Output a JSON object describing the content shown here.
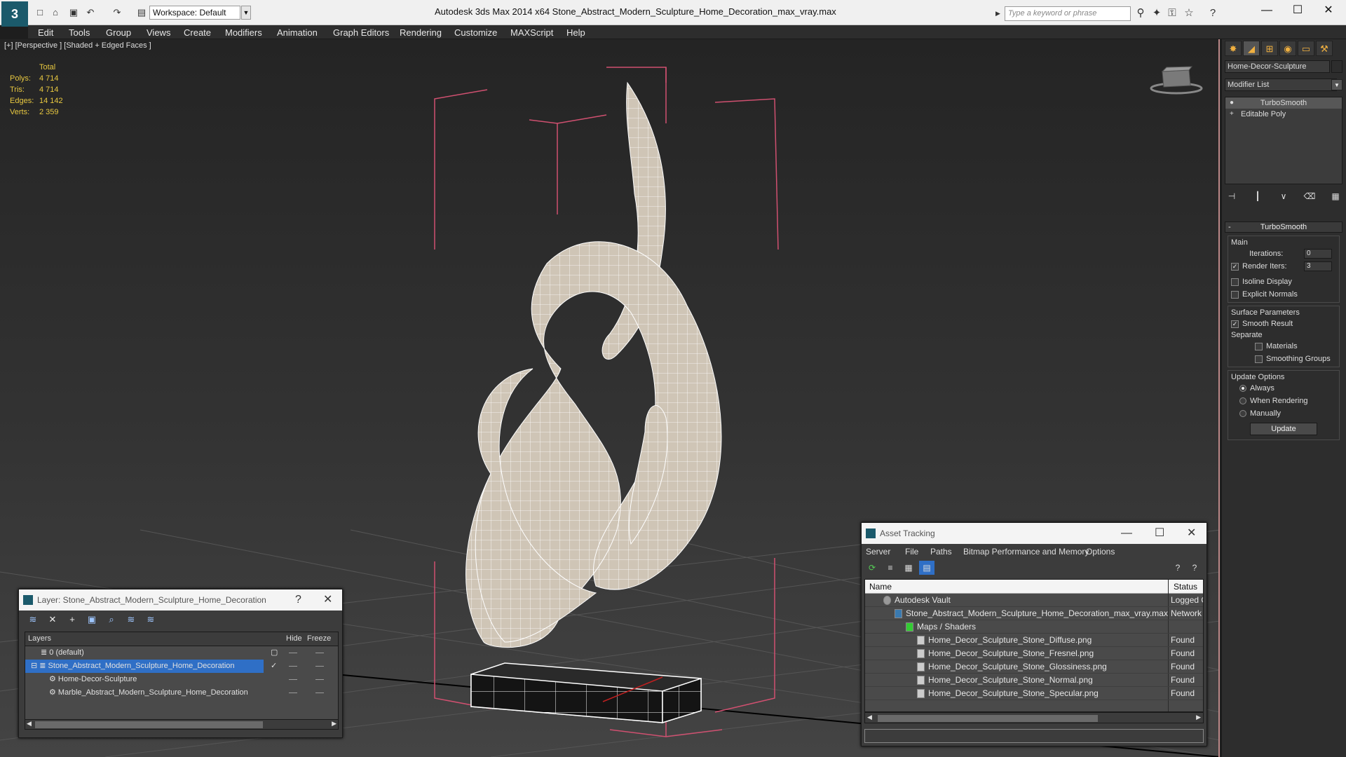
{
  "window": {
    "title": "Autodesk 3ds Max  2014 x64      Stone_Abstract_Modern_Sculpture_Home_Decoration_max_vray.max",
    "workspace": "Workspace: Default",
    "search_placeholder": "Type a keyword or phrase"
  },
  "menu": [
    "Edit",
    "Tools",
    "Group",
    "Views",
    "Create",
    "Modifiers",
    "Animation",
    "Graph Editors",
    "Rendering",
    "Customize",
    "MAXScript",
    "Help"
  ],
  "viewport": {
    "label": "[+] [Perspective ] [Shaded + Edged Faces ]",
    "stats": {
      "header": "Total",
      "rows": [
        {
          "key": "Polys:",
          "value": "4 714"
        },
        {
          "key": "Tris:",
          "value": "4 714"
        },
        {
          "key": "Edges:",
          "value": "14 142"
        },
        {
          "key": "Verts:",
          "value": "2 359"
        }
      ]
    }
  },
  "command_panel": {
    "object_name": "Home-Decor-Sculpture",
    "modifier_list": "Modifier List",
    "stack": [
      "TurboSmooth",
      "Editable Poly"
    ],
    "turbosmooth": {
      "title": "TurboSmooth",
      "main_label": "Main",
      "iterations_label": "Iterations:",
      "iterations_value": "0",
      "render_iters_label": "Render Iters:",
      "render_iters_value": "3",
      "isoline": "Isoline Display",
      "explicit": "Explicit Normals",
      "surface_label": "Surface Parameters",
      "smooth_result": "Smooth Result",
      "separate_label": "Separate",
      "materials": "Materials",
      "smoothing_groups": "Smoothing Groups",
      "update_label": "Update Options",
      "always": "Always",
      "when_rendering": "When Rendering",
      "manually": "Manually",
      "update_button": "Update"
    }
  },
  "layer_dialog": {
    "title": "Layer: Stone_Abstract_Modern_Sculpture_Home_Decoration",
    "help": "?",
    "columns": {
      "layers": "Layers",
      "hide": "Hide",
      "freeze": "Freeze"
    },
    "rows": [
      {
        "name": "0 (default)"
      },
      {
        "name": "Stone_Abstract_Modern_Sculpture_Home_Decoration"
      },
      {
        "name": "Home-Decor-Sculpture"
      },
      {
        "name": "Marble_Abstract_Modern_Sculpture_Home_Decoration"
      }
    ]
  },
  "asset_dialog": {
    "title": "Asset Tracking",
    "menu": [
      "Server",
      "File",
      "Paths",
      "Bitmap Performance and Memory",
      "Options"
    ],
    "columns": {
      "name": "Name",
      "status": "Status"
    },
    "rows": [
      {
        "name": "Autodesk Vault",
        "status": "Logged O"
      },
      {
        "name": "Stone_Abstract_Modern_Sculpture_Home_Decoration_max_vray.max",
        "status": "Network"
      },
      {
        "name": "Maps / Shaders",
        "status": ""
      },
      {
        "name": "Home_Decor_Sculpture_Stone_Diffuse.png",
        "status": "Found"
      },
      {
        "name": "Home_Decor_Sculpture_Stone_Fresnel.png",
        "status": "Found"
      },
      {
        "name": "Home_Decor_Sculpture_Stone_Glossiness.png",
        "status": "Found"
      },
      {
        "name": "Home_Decor_Sculpture_Stone_Normal.png",
        "status": "Found"
      },
      {
        "name": "Home_Decor_Sculpture_Stone_Specular.png",
        "status": "Found"
      }
    ]
  },
  "colors": {
    "accent": "#2f6fc6",
    "stats": "#e8c840",
    "bbox": "#d05070"
  }
}
